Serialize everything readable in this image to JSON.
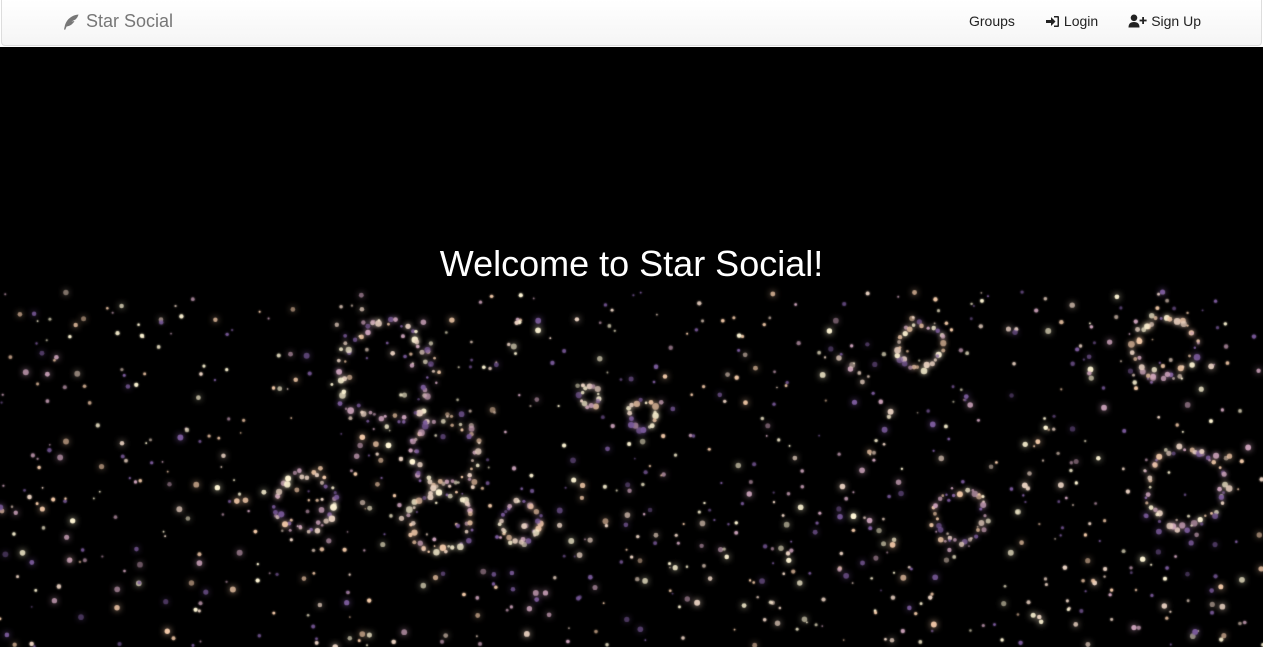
{
  "brand": {
    "icon": "feather-icon",
    "name": "Star Social"
  },
  "nav": {
    "groups_label": "Groups",
    "login_label": "Login",
    "login_icon": "sign-in-icon",
    "signup_label": "Sign Up",
    "signup_icon": "user-plus-icon"
  },
  "hero": {
    "heading": "Welcome to Star Social!"
  },
  "colors": {
    "navbar_bg": "#f8f8f8",
    "brand_text": "#777777",
    "nav_text": "#222222",
    "hero_bg": "#000000",
    "heading_text": "#ffffff",
    "particle_colors": [
      "#fff6d5",
      "#f2c9a8",
      "#c9a0b8",
      "#7a5a9a",
      "#e8d0c0"
    ]
  }
}
